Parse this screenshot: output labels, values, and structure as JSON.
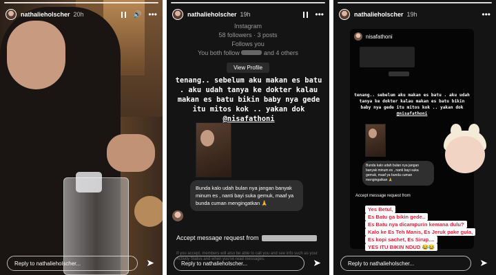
{
  "panels": [
    {
      "username": "nathalieholscher",
      "time": "20h",
      "reply_placeholder": "Reply to nathalieholscher..."
    },
    {
      "username": "nathalieholscher",
      "time": "19h",
      "profile_header": {
        "platform": "Instagram",
        "stats": "58 followers · 3 posts",
        "follows": "Follows you",
        "mutual": "You both follow",
        "mutual_suffix": "and 4 others",
        "view_profile": "View Profile"
      },
      "caption": "tenang.. sebelum aku makan es batu . aku udah tanya ke dokter kalau makan es batu bikin baby nya gede itu mitos kok .. yakan dok",
      "mention": "@nisafathoni",
      "dm_message": "Bunda kalo udah bulan nya jangan banyak minum es , nanti bayi suka gemuk, maaf ya bunda cuman mengingatkan 🙏",
      "accept_text": "Accept message request from",
      "faint_text": "If you accept, members will also be able to call you and see info such as your Activity Status and when you've read messages.",
      "reply_placeholder": "Reply to nathalieholscher..."
    },
    {
      "username": "nathalieholscher",
      "time": "19h",
      "shared_user": "nisafathoni",
      "reply_placeholder": "Reply to nathalieholscher...",
      "reply_lines": [
        "Yes Betul,",
        "Es Batu ga bikin gede..",
        "Es Batu nya dicampurin kemana dulu?",
        "Kalo ke Es Teh Manis, Es Jeruk pake gula,",
        "Es kopi sachet, Es Sirup....",
        "YES ITU BIKIN NDUD 😂😂"
      ]
    }
  ],
  "icons": [
    "pause-icon",
    "speaker-icon",
    "more-icon",
    "send-icon"
  ],
  "colors": {
    "accent_pink": "#e0223b",
    "dark_bg": "#141414"
  }
}
